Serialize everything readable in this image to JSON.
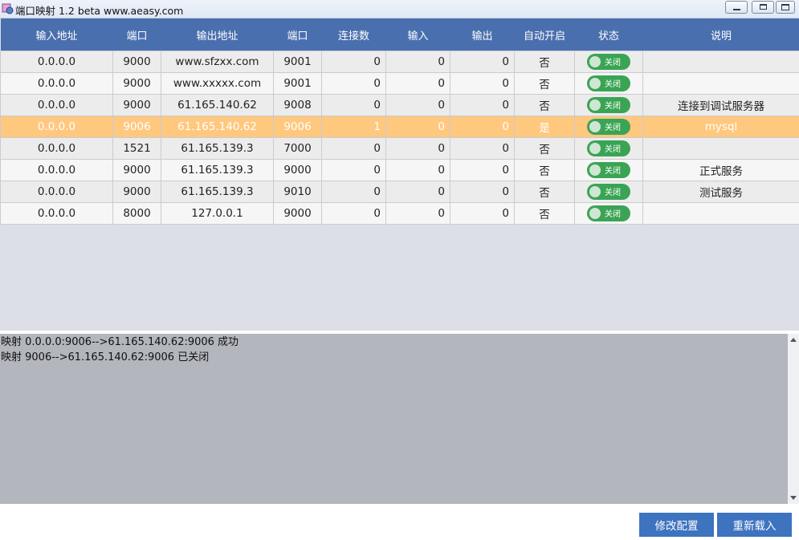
{
  "window": {
    "title": "端口映射 1.2 beta www.aeasy.com",
    "controls": [
      "minimize",
      "maximize",
      "close"
    ]
  },
  "table": {
    "columns": [
      "输入地址",
      "端口",
      "输出地址",
      "端口",
      "连接数",
      "输入",
      "输出",
      "自动开启",
      "状态",
      "说明"
    ],
    "rows": [
      {
        "in_addr": "0.0.0.0",
        "in_port": "9000",
        "out_addr": "www.sfzxx.com",
        "out_port": "9001",
        "conns": "0",
        "input": "0",
        "output": "0",
        "auto": "否",
        "status": "关闭",
        "desc": ""
      },
      {
        "in_addr": "0.0.0.0",
        "in_port": "9000",
        "out_addr": "www.xxxxx.com",
        "out_port": "9001",
        "conns": "0",
        "input": "0",
        "output": "0",
        "auto": "否",
        "status": "关闭",
        "desc": ""
      },
      {
        "in_addr": "0.0.0.0",
        "in_port": "9000",
        "out_addr": "61.165.140.62",
        "out_port": "9008",
        "conns": "0",
        "input": "0",
        "output": "0",
        "auto": "否",
        "status": "关闭",
        "desc": "连接到调试服务器"
      },
      {
        "in_addr": "0.0.0.0",
        "in_port": "9006",
        "out_addr": "61.165.140.62",
        "out_port": "9006",
        "conns": "1",
        "input": "0",
        "output": "0",
        "auto": "是",
        "status": "关闭",
        "desc": "mysql"
      },
      {
        "in_addr": "0.0.0.0",
        "in_port": "1521",
        "out_addr": "61.165.139.3",
        "out_port": "7000",
        "conns": "0",
        "input": "0",
        "output": "0",
        "auto": "否",
        "status": "关闭",
        "desc": ""
      },
      {
        "in_addr": "0.0.0.0",
        "in_port": "9000",
        "out_addr": "61.165.139.3",
        "out_port": "9000",
        "conns": "0",
        "input": "0",
        "output": "0",
        "auto": "否",
        "status": "关闭",
        "desc": "正式服务"
      },
      {
        "in_addr": "0.0.0.0",
        "in_port": "9000",
        "out_addr": "61.165.139.3",
        "out_port": "9010",
        "conns": "0",
        "input": "0",
        "output": "0",
        "auto": "否",
        "status": "关闭",
        "desc": "测试服务"
      },
      {
        "in_addr": "0.0.0.0",
        "in_port": "8000",
        "out_addr": "127.0.0.1",
        "out_port": "9000",
        "conns": "0",
        "input": "0",
        "output": "0",
        "auto": "否",
        "status": "关闭",
        "desc": ""
      }
    ],
    "selected_row_index": 3
  },
  "log": {
    "lines": [
      "映射 0.0.0.0:9006-->61.165.140.62:9006 成功",
      "映射 9006-->61.165.140.62:9006 已关闭"
    ]
  },
  "buttons": {
    "edit_config": "修改配置",
    "reload": "重新载入"
  },
  "colors": {
    "header_bg": "#4a6fae",
    "selected_row": "#ffc87f",
    "toggle_green": "#3aa454",
    "button_blue": "#3d73bf",
    "log_bg": "#b3b6bd"
  }
}
